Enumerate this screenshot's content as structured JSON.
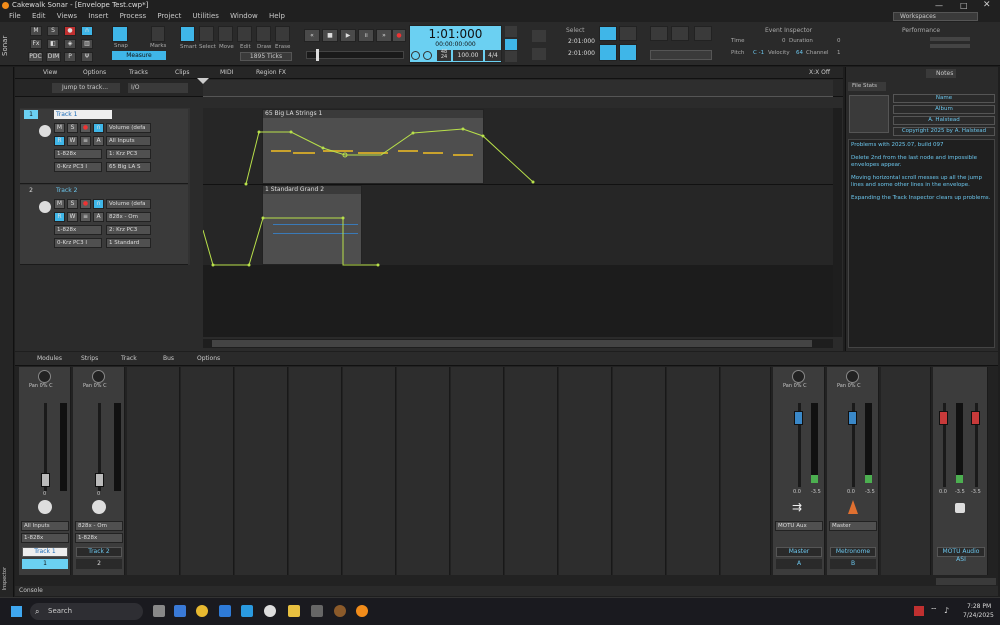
{
  "window": {
    "title": "Cakewalk Sonar - [Envelope Test.cwp*]"
  },
  "menu": [
    "File",
    "Edit",
    "Views",
    "Insert",
    "Process",
    "Project",
    "Utilities",
    "Window",
    "Help"
  ],
  "workspaces": "Workspaces",
  "control_bar": {
    "snap_label": "Snap",
    "snap_value": "Measure",
    "marks_label": "Marks",
    "tools": [
      "Smart",
      "Select",
      "Move",
      "Edit",
      "Draw",
      "Erase"
    ],
    "ticks_value": "1895 Ticks",
    "now_time": "1:01:000",
    "now_time_sub": "00:00:00:000",
    "meter_top": "48",
    "meter_bottom": "24",
    "tempo": "100.00",
    "time_sig": "4/4",
    "select_label": "Select",
    "select_start": "2:01:000",
    "select_end": "2:01:000",
    "event_inspector": "Event Inspector",
    "ev_time": "Time",
    "ev_pitch": "Pitch",
    "ev_duration": "Duration",
    "ev_velocity": "Velocity",
    "ev_channel": "Channel",
    "ev_pitch_val": "C -1",
    "ev_velocity_val": "64",
    "ev_duration_val": "0",
    "ev_channel_val": "1",
    "ev_time_val": "0",
    "performance": "Performance"
  },
  "track_view_menu": [
    "View",
    "Options",
    "Tracks",
    "Clips",
    "MIDI",
    "Region FX"
  ],
  "jump_placeholder": "Jump to track...",
  "io_label": "I/O",
  "xx_off": "X:X Off",
  "tracks": [
    {
      "num": "1",
      "name": "Track 1",
      "volume": "Volume (defa",
      "input": "All Inputs",
      "output": "1: Krz PC3",
      "port": "1-828x",
      "instr": "65 Big LA S",
      "port2": "0-Krz PC3 I"
    },
    {
      "num": "2",
      "name": "Track 2",
      "volume": "Volume (defa",
      "input": "828x - Om",
      "output": "2: Krz PC3",
      "port": "1-828x",
      "instr": "1 Standard",
      "port2": "0-Krz PC3 I"
    }
  ],
  "clips": [
    {
      "name": "65 Big LA Strings 1"
    },
    {
      "name": "1 Standard Grand 2"
    }
  ],
  "inspector": {
    "tabs": [
      "File Stats",
      "Notes"
    ],
    "fields": [
      "Name",
      "Album",
      "A. Halstead",
      "Copyright 2025 by A. Halstead"
    ],
    "notes": [
      "Problems with 2025.07, build 097",
      "Delete 2nd from the last node and impossible envelopes appear.",
      "Moving horizontal scroll messes up all the jump lines and some other lines in the envelope.",
      "Expanding the Track Inspector clears up problems."
    ]
  },
  "console_menu": [
    "Modules",
    "Strips",
    "Track",
    "Bus",
    "Options"
  ],
  "strips": [
    {
      "pan": "Pan 0% C",
      "input": "All Inputs",
      "port": "1-828x",
      "name": "Track 1",
      "num": "1",
      "vol": "0"
    },
    {
      "pan": "Pan 0% C",
      "input": "828x - Om",
      "port": "1-828x",
      "name": "Track 2",
      "num": "2",
      "vol": "0"
    }
  ],
  "buses": [
    {
      "pan": "Pan 0% C",
      "output": "MOTU Aux",
      "name": "Master",
      "num": "A",
      "vol": "0.0",
      "peak": "-3.5"
    },
    {
      "pan": "Pan 0% C",
      "output": "Master",
      "name": "Metronome",
      "num": "B",
      "vol": "0.0",
      "peak": "-3.5"
    }
  ],
  "main_out": {
    "name": "MOTU Audio ASI",
    "vol": "0.0",
    "peak": "-3.5",
    "peak2": "-3.5"
  },
  "console_label": "Console",
  "side_label": "Sonar",
  "inspector_label": "Inspector",
  "taskbar": {
    "search": "Search",
    "time": "7:28 PM",
    "date": "7/24/2025"
  }
}
